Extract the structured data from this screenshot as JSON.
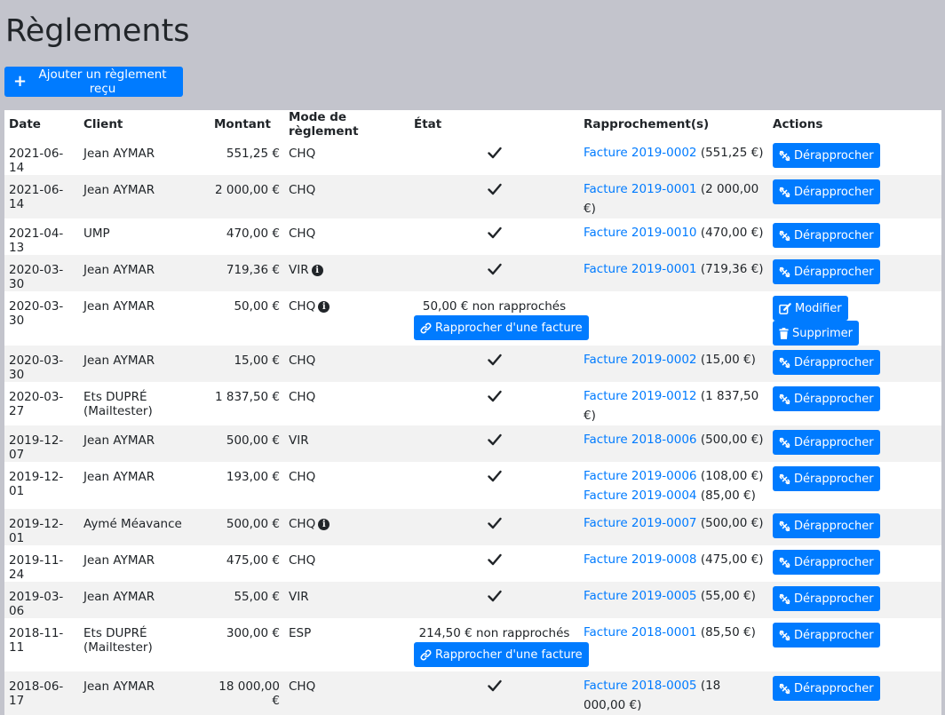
{
  "page": {
    "title": "Règlements",
    "add_button": "Ajouter un règlement reçu"
  },
  "table": {
    "headers": {
      "date": "Date",
      "client": "Client",
      "montant": "Montant",
      "mode": "Mode de règlement",
      "etat": "État",
      "rapprochements": "Rapprochement(s)",
      "actions": "Actions"
    },
    "labels": {
      "derapprocher": "Dérapprocher",
      "modifier": "Modifier",
      "supprimer": "Supprimer",
      "rapprocher": "Rapprocher d'une facture"
    },
    "rows": [
      {
        "date": "2021-06-14",
        "client": "Jean AYMAR",
        "montant": "551,25 €",
        "mode": "CHQ",
        "info": false,
        "state": "ok",
        "links": [
          {
            "invoice": "Facture 2019-0002",
            "amount": "(551,25 €)"
          }
        ]
      },
      {
        "date": "2021-06-14",
        "client": "Jean AYMAR",
        "montant": "2 000,00 €",
        "mode": "CHQ",
        "info": false,
        "state": "ok",
        "links": [
          {
            "invoice": "Facture 2019-0001",
            "amount": "(2 000,00 €)"
          }
        ]
      },
      {
        "date": "2021-04-13",
        "client": "UMP",
        "montant": "470,00 €",
        "mode": "CHQ",
        "info": false,
        "state": "ok",
        "links": [
          {
            "invoice": "Facture 2019-0010",
            "amount": "(470,00 €)"
          }
        ]
      },
      {
        "date": "2020-03-30",
        "client": "Jean AYMAR",
        "montant": "719,36 €",
        "mode": "VIR",
        "info": true,
        "state": "ok",
        "links": [
          {
            "invoice": "Facture 2019-0001",
            "amount": "(719,36 €)"
          }
        ]
      },
      {
        "date": "2020-03-30",
        "client": "Jean AYMAR",
        "montant": "50,00 €",
        "mode": "CHQ",
        "info": true,
        "state": "pending",
        "unmatched": "50,00 € non rapprochés",
        "links": []
      },
      {
        "date": "2020-03-30",
        "client": "Jean AYMAR",
        "montant": "15,00 €",
        "mode": "CHQ",
        "info": false,
        "state": "ok",
        "links": [
          {
            "invoice": "Facture 2019-0002",
            "amount": "(15,00 €)"
          }
        ]
      },
      {
        "date": "2020-03-27",
        "client": "Ets DUPRÉ (Mailtester)",
        "montant": "1 837,50 €",
        "mode": "CHQ",
        "info": false,
        "state": "ok",
        "links": [
          {
            "invoice": "Facture 2019-0012",
            "amount": "(1 837,50 €)"
          }
        ]
      },
      {
        "date": "2019-12-07",
        "client": "Jean AYMAR",
        "montant": "500,00 €",
        "mode": "VIR",
        "info": false,
        "state": "ok",
        "links": [
          {
            "invoice": "Facture 2018-0006",
            "amount": "(500,00 €)"
          }
        ]
      },
      {
        "date": "2019-12-01",
        "client": "Jean AYMAR",
        "montant": "193,00 €",
        "mode": "CHQ",
        "info": false,
        "state": "ok",
        "links": [
          {
            "invoice": "Facture 2019-0006",
            "amount": "(108,00 €)"
          },
          {
            "invoice": "Facture 2019-0004",
            "amount": "(85,00 €)"
          }
        ]
      },
      {
        "date": "2019-12-01",
        "client": "Aymé Méavance",
        "montant": "500,00 €",
        "mode": "CHQ",
        "info": true,
        "state": "ok",
        "links": [
          {
            "invoice": "Facture 2019-0007",
            "amount": "(500,00 €)"
          }
        ]
      },
      {
        "date": "2019-11-24",
        "client": "Jean AYMAR",
        "montant": "475,00 €",
        "mode": "CHQ",
        "info": false,
        "state": "ok",
        "links": [
          {
            "invoice": "Facture 2019-0008",
            "amount": "(475,00 €)"
          }
        ]
      },
      {
        "date": "2019-03-06",
        "client": "Jean AYMAR",
        "montant": "55,00 €",
        "mode": "VIR",
        "info": false,
        "state": "ok",
        "links": [
          {
            "invoice": "Facture 2019-0005",
            "amount": "(55,00 €)"
          }
        ]
      },
      {
        "date": "2018-11-11",
        "client": "Ets DUPRÉ (Mailtester)",
        "montant": "300,00 €",
        "mode": "ESP",
        "info": false,
        "state": "partial",
        "unmatched": "214,50 € non rapprochés",
        "links": [
          {
            "invoice": "Facture 2018-0001",
            "amount": "(85,50 €)"
          }
        ]
      },
      {
        "date": "2018-06-17",
        "client": "Jean AYMAR",
        "montant": "18 000,00 €",
        "mode": "CHQ",
        "info": false,
        "state": "ok",
        "links": [
          {
            "invoice": "Facture 2018-0005",
            "amount": "(18 000,00 €)"
          }
        ]
      }
    ]
  },
  "colors": {
    "primary": "#007bff",
    "page_bg": "#c3c4cc",
    "row_alt": "#f2f2f2"
  },
  "icons": {
    "add": "plus-icon",
    "unlink": "unlink-icon",
    "link": "link-icon",
    "edit": "edit-icon",
    "delete": "trash-icon",
    "state_ok": "check-icon",
    "info": "info-circle-icon"
  }
}
